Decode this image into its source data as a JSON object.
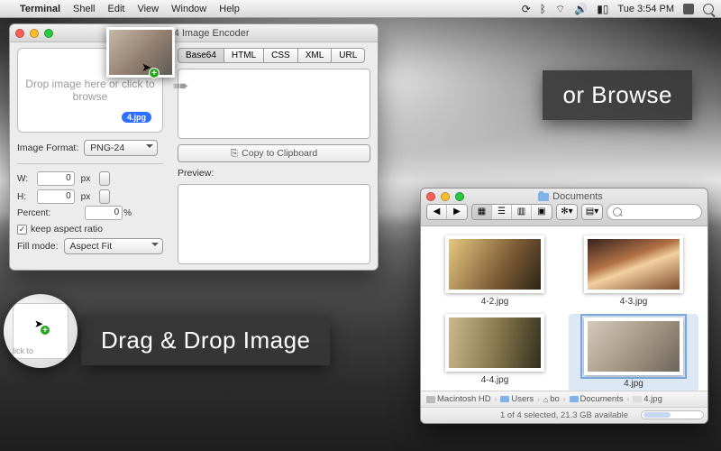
{
  "menubar": {
    "app": "Terminal",
    "items": [
      "Shell",
      "Edit",
      "View",
      "Window",
      "Help"
    ],
    "clock": "Tue 3:54 PM"
  },
  "encoder": {
    "title": "Base64 Image Encoder",
    "drop_text_1": "Drop image here or click to",
    "drop_text_2": "browse",
    "drop_badge": "4.jpg",
    "format_label": "Image Format:",
    "format_value": "PNG-24",
    "w_label": "W:",
    "h_label": "H:",
    "w_value": "0",
    "h_value": "0",
    "unit": "px",
    "percent_label": "Percent:",
    "percent_value": "0",
    "percent_unit": "%",
    "keep_ratio": "keep aspect ratio",
    "fillmode_label": "Fill mode:",
    "fillmode_value": "Aspect Fit",
    "tabs": [
      "Base64",
      "HTML",
      "CSS",
      "XML",
      "URL"
    ],
    "active_tab": "Base64",
    "copy_btn": "Copy to Clipboard",
    "preview_label": "Preview:"
  },
  "captions": {
    "drag": "Drag & Drop Image",
    "browse": "or Browse"
  },
  "bubble_text": "lick to",
  "finder": {
    "title": "Documents",
    "files": [
      {
        "name": "4-2.jpg"
      },
      {
        "name": "4-3.jpg"
      },
      {
        "name": "4-4.jpg"
      },
      {
        "name": "4.jpg",
        "selected": true
      }
    ],
    "path": [
      "Macintosh HD",
      "Users",
      "bo",
      "Documents",
      "4.jpg"
    ],
    "status": "1 of 4 selected, 21.3 GB available"
  }
}
